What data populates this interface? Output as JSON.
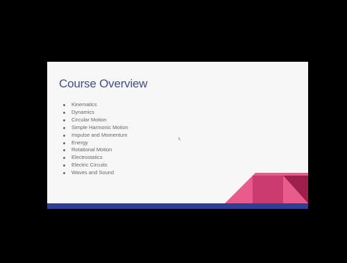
{
  "slide": {
    "title": "Course Overview",
    "bullets": [
      "Kinematics",
      "Dynamics",
      "Circular Motion",
      "Simple Harmonic Motion",
      "Impulse and Momentum",
      "Energy",
      "Rotational Motion",
      "Electrostatics",
      "Electric Circuits",
      "Waves and Sound"
    ]
  },
  "colors": {
    "background": "#000000",
    "slide_background": "#f7f7f7",
    "title": "#3d4f91",
    "footer_bar": "#2f3f94",
    "accent_pink": "#e85b8a",
    "accent_magenta": "#c8376b",
    "accent_dark": "#9c1f4c"
  },
  "icons": {
    "cursor": "mouse-cursor-icon"
  }
}
